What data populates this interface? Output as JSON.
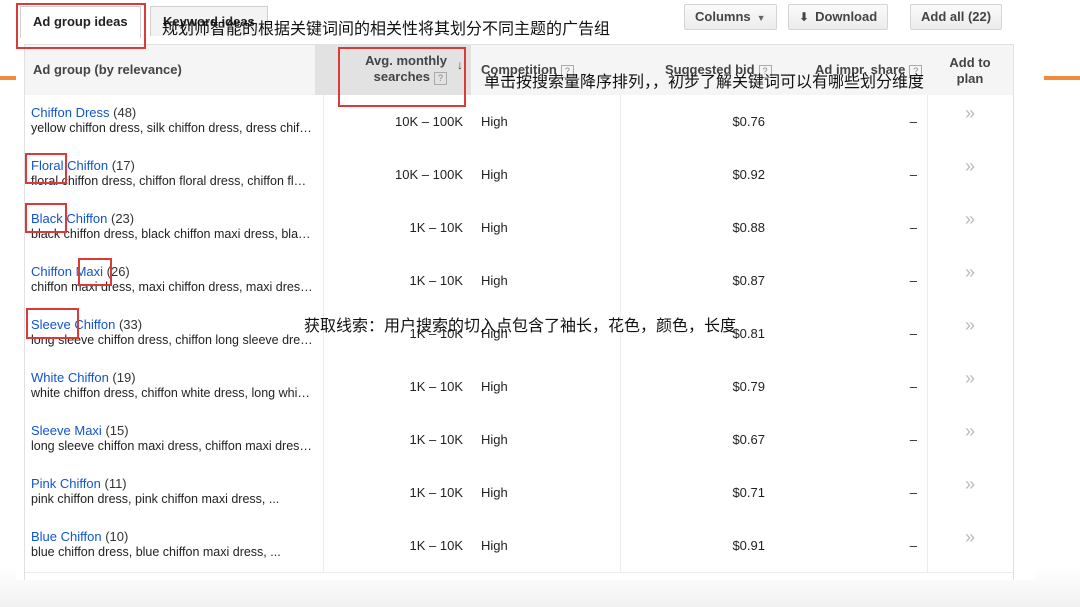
{
  "toolbar": {
    "tab_active": "Ad group ideas",
    "tab_inactive": "Keyword ideas",
    "columns_label": "Columns",
    "download_label": "Download",
    "add_all_label": "Add all (22)"
  },
  "headers": {
    "group": "Ad group (by relevance)",
    "searches_line1": "Avg. monthly",
    "searches_line2": "searches",
    "competition": "Competition",
    "bid": "Suggested bid",
    "share": "Ad impr. share",
    "add_line1": "Add to",
    "add_line2": "plan"
  },
  "rows": [
    {
      "name": "Chiffon Dress",
      "count": "(48)",
      "keywords": "yellow chiffon dress, silk chiffon dress, dress chiffon, ...",
      "searches": "10K – 100K",
      "competition": "High",
      "bid": "$0.76",
      "share": "–",
      "add": "»"
    },
    {
      "name": "Floral Chiffon",
      "count": "(17)",
      "keywords": "floral chiffon dress, chiffon floral dress, chiffon floral maxi ...",
      "searches": "10K – 100K",
      "competition": "High",
      "bid": "$0.92",
      "share": "–",
      "add": "»"
    },
    {
      "name": "Black Chiffon",
      "count": "(23)",
      "keywords": "black chiffon dress, black chiffon maxi dress, black ...",
      "searches": "1K – 10K",
      "competition": "High",
      "bid": "$0.88",
      "share": "–",
      "add": "»"
    },
    {
      "name": "Chiffon Maxi",
      "count": "(26)",
      "keywords": "chiffon maxi dress, maxi chiffon dress, maxi dress ...",
      "searches": "1K – 10K",
      "competition": "High",
      "bid": "$0.87",
      "share": "–",
      "add": "»"
    },
    {
      "name": "Sleeve Chiffon",
      "count": "(33)",
      "keywords": "long sleeve chiffon dress, chiffon long sleeve dress, ...",
      "searches": "1K – 10K",
      "competition": "High",
      "bid": "$0.81",
      "share": "–",
      "add": "»"
    },
    {
      "name": "White Chiffon",
      "count": "(19)",
      "keywords": "white chiffon dress, chiffon white dress, long white ...",
      "searches": "1K – 10K",
      "competition": "High",
      "bid": "$0.79",
      "share": "–",
      "add": "»"
    },
    {
      "name": "Sleeve Maxi",
      "count": "(15)",
      "keywords": "long sleeve chiffon maxi dress, chiffon maxi dress ...",
      "searches": "1K – 10K",
      "competition": "High",
      "bid": "$0.67",
      "share": "–",
      "add": "»"
    },
    {
      "name": "Pink Chiffon",
      "count": "(11)",
      "keywords": "pink chiffon dress, pink chiffon maxi dress, ...",
      "searches": "1K – 10K",
      "competition": "High",
      "bid": "$0.71",
      "share": "–",
      "add": "»"
    },
    {
      "name": "Blue Chiffon",
      "count": "(10)",
      "keywords": "blue chiffon dress, blue chiffon maxi dress, ...",
      "searches": "1K – 10K",
      "competition": "High",
      "bid": "$0.91",
      "share": "–",
      "add": "»"
    }
  ],
  "annotations": {
    "note_top": "规划师智能的根据关键词间的相关性将其划分不同主题的广告组",
    "note_sort": "单击按搜索量降序排列，，初步了解关键词可以有哪些划分维度",
    "note_clue": "获取线索：用户搜索的切入点包含了袖长，花色，颜色，长度"
  },
  "colors": {
    "link": "#1155cc",
    "annotation_box": "#d93a3a",
    "slide_accent": "#f08a3c"
  }
}
